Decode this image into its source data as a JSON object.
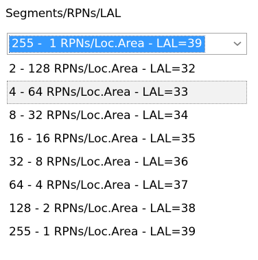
{
  "field": {
    "label": "Segments/RPNs/LAL"
  },
  "combo": {
    "selected_value": "255 -  1 RPNs/Loc.Area - LAL=39",
    "arrow_icon": "chevron-down-icon"
  },
  "options": [
    {
      "label": "2 - 128 RPNs/Loc.Area - LAL=32"
    },
    {
      "label": "4 - 64 RPNs/Loc.Area - LAL=33"
    },
    {
      "label": "8 - 32 RPNs/Loc.Area - LAL=34"
    },
    {
      "label": "16 - 16 RPNs/Loc.Area - LAL=35"
    },
    {
      "label": "32 - 8 RPNs/Loc.Area - LAL=36"
    },
    {
      "label": "64 - 4 RPNs/Loc.Area - LAL=37"
    },
    {
      "label": "128 - 2 RPNs/Loc.Area - LAL=38"
    },
    {
      "label": "255 - 1 RPNs/Loc.Area - LAL=39"
    }
  ],
  "colors": {
    "selection_bg": "#3399ff",
    "selection_text": "#ffffff",
    "hover_bg": "#f2f2f2",
    "border": "#a6a6a6"
  }
}
